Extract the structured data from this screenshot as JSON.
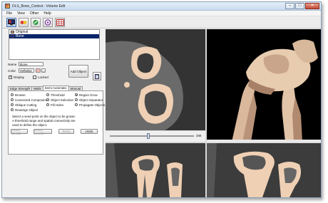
{
  "window": {
    "title": "DLS_Bone_Control - Volume Edit",
    "minimize": "–",
    "maximize": "□",
    "close": "✕"
  },
  "menu": [
    "File",
    "View",
    "Other",
    "Help"
  ],
  "toolbar": {
    "icons": [
      "monitor-icon",
      "colors-icon",
      "wand-icon",
      "palette-icon",
      "grid-icon"
    ]
  },
  "objects": [
    {
      "label": "Original",
      "color": "#d8a080",
      "selected": false
    },
    {
      "label": "Bone",
      "color": "#1a1aa0",
      "selected": true
    }
  ],
  "props": {
    "name_label": "Name",
    "name_value": "Bone",
    "color_label": "Color",
    "color_value": "#efb8b3",
    "color_swatch": "#efb8b3",
    "color_btn": "...",
    "display_label": "Display",
    "locked_label": "Locked",
    "add_object": "Add Object",
    "display_check": "✓"
  },
  "tabs": [
    "Edge Strength",
    "Walls",
    "Semi-Automatic",
    "Manual"
  ],
  "active_tab": 2,
  "tools": {
    "col1": [
      "Browse",
      "Connected Components",
      "Oblique Cutting",
      "Reassign Object"
    ],
    "col2": [
      "Threshold",
      "Object Selection",
      "Fill Holes"
    ],
    "col3": [
      "Region Grow",
      "Object Separator",
      "Propagate Objects"
    ],
    "selected": "Region Grow"
  },
  "help_text": [
    "Select a seed point on the object to be grown.",
    "A threshold range and spatial connectivity are",
    "used to define the object."
  ],
  "actions": [
    "Reset Seeds",
    "Reset Levels",
    "Redo",
    "Undo"
  ],
  "slider": {
    "value": "256"
  },
  "colors": {
    "bone": "#efd0b4",
    "accent": "#0a246a"
  }
}
